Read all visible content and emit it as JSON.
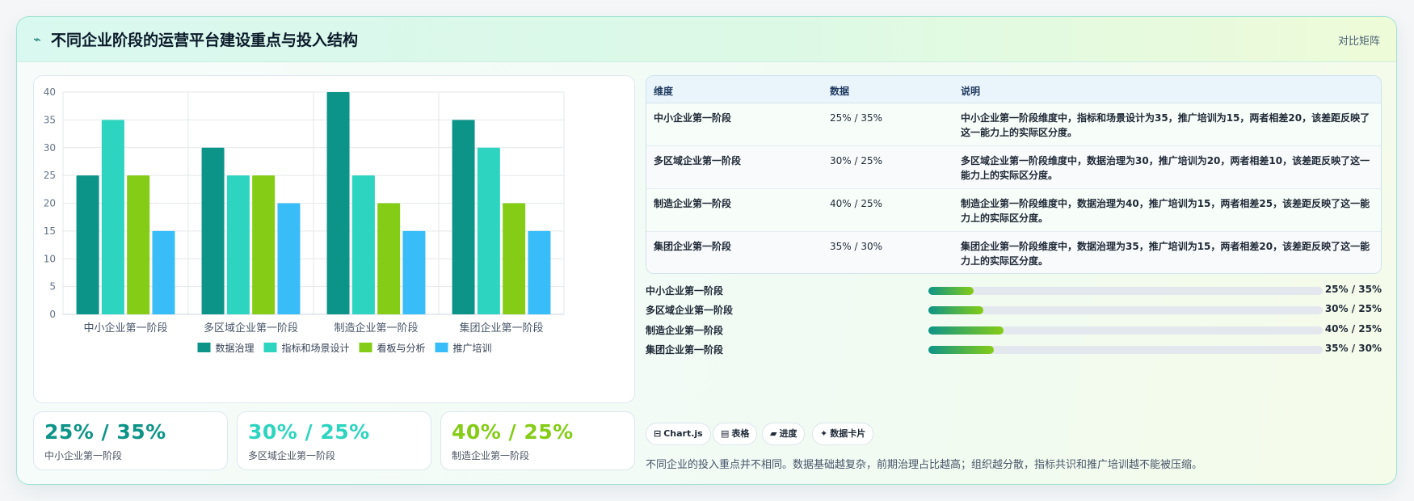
{
  "header": {
    "icon": "bolt-icon",
    "title": "不同企业阶段的运营平台建设重点与投入结构",
    "tag": "对比矩阵"
  },
  "colors": {
    "series": [
      "#0d9488",
      "#2dd4bf",
      "#84cc16",
      "#38bdf8"
    ]
  },
  "chart_data": {
    "type": "bar",
    "categories": [
      "中小企业第一阶段",
      "多区域企业第一阶段",
      "制造企业第一阶段",
      "集团企业第一阶段"
    ],
    "series": [
      {
        "name": "数据治理",
        "values": [
          25,
          30,
          40,
          35
        ]
      },
      {
        "name": "指标和场景设计",
        "values": [
          35,
          25,
          25,
          30
        ]
      },
      {
        "name": "看板与分析",
        "values": [
          25,
          25,
          20,
          20
        ]
      },
      {
        "name": "推广培训",
        "values": [
          15,
          20,
          15,
          15
        ]
      }
    ],
    "ylim": [
      0,
      40
    ],
    "yticks": [
      0,
      5,
      10,
      15,
      20,
      25,
      30,
      35,
      40
    ],
    "grid": true,
    "legend": "bottom"
  },
  "table": {
    "headers": [
      "维度",
      "数据",
      "说明"
    ],
    "rows": [
      [
        "中小企业第一阶段",
        "25% / 35%",
        "中小企业第一阶段维度中，指标和场景设计为35，推广培训为15，两者相差20，该差距反映了这一能力上的实际区分度。"
      ],
      [
        "多区域企业第一阶段",
        "30% / 25%",
        "多区域企业第一阶段维度中，数据治理为30，推广培训为20，两者相差10，该差距反映了这一能力上的实际区分度。"
      ],
      [
        "制造企业第一阶段",
        "40% / 25%",
        "制造企业第一阶段维度中，数据治理为40，推广培训为15，两者相差25，该差距反映了这一能力上的实际区分度。"
      ],
      [
        "集团企业第一阶段",
        "35% / 30%",
        "集团企业第一阶段维度中，数据治理为35，推广培训为15，两者相差20，该差距反映了这一能力上的实际区分度。"
      ]
    ]
  },
  "progress": [
    {
      "label": "中小企业第一阶段",
      "value": "25% / 35%",
      "fraction": 0.115
    },
    {
      "label": "多区域企业第一阶段",
      "value": "30% / 25%",
      "fraction": 0.14
    },
    {
      "label": "制造企业第一阶段",
      "value": "40% / 25%",
      "fraction": 0.19
    },
    {
      "label": "集团企业第一阶段",
      "value": "35% / 30%",
      "fraction": 0.165
    }
  ],
  "kpis": [
    {
      "value": "25% / 35%",
      "label": "中小企业第一阶段",
      "color": "#0d9488"
    },
    {
      "value": "30% / 25%",
      "label": "多区域企业第一阶段",
      "color": "#2dd4bf"
    },
    {
      "value": "40% / 25%",
      "label": "制造企业第一阶段",
      "color": "#84cc16"
    }
  ],
  "chips": [
    {
      "icon": "chart-icon",
      "glyph": "⊟",
      "label": "Chart.js"
    },
    {
      "icon": "table-icon",
      "glyph": "▤",
      "label": "表格"
    },
    {
      "icon": "progress-icon",
      "glyph": "▰",
      "label": "进度"
    },
    {
      "icon": "sparkle-icon",
      "glyph": "✦",
      "label": "数据卡片"
    }
  ],
  "note": "不同企业的投入重点并不相同。数据基础越复杂，前期治理占比越高；组织越分散，指标共识和推广培训越不能被压缩。"
}
